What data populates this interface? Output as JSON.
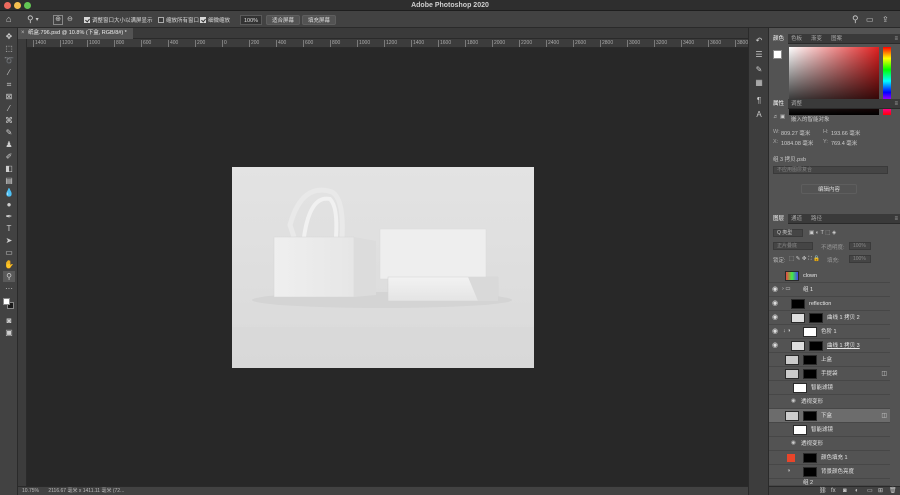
{
  "titlebar": {
    "app_title": "Adobe Photoshop 2020"
  },
  "options_bar": {
    "resize_windows": "调整窗口大小以满屏显示",
    "zoom_all_windows": "缩放所有窗口",
    "scrubby_zoom": "细微缩放",
    "zoom_value": "100%",
    "fit_screen": "适合屏幕",
    "fill_screen": "填充屏幕"
  },
  "document": {
    "tab_title": "纸盒.796.psd @ 10.8% (下盒, RGB/8#) *"
  },
  "ruler_ticks": [
    "1400",
    "1200",
    "1000",
    "800",
    "600",
    "400",
    "200",
    "0",
    "200",
    "400",
    "600",
    "800",
    "1000",
    "1200",
    "1400",
    "1600",
    "1800",
    "2000",
    "2200",
    "2400",
    "2600",
    "2800",
    "3000",
    "3200",
    "3400",
    "3600",
    "3800"
  ],
  "status_bar": {
    "zoom": "10.75%",
    "doc_info": "2116.67 毫米 x 1411.11 毫米 (72..."
  },
  "color_panel": {
    "tabs": [
      "颜色",
      "色板",
      "渐变",
      "图案"
    ],
    "colors": {
      "foreground": "#ffffff",
      "background": "#1a1a1a"
    }
  },
  "properties_panel": {
    "tabs": [
      "属性",
      "调整"
    ],
    "type_label": "嵌入的智能对象",
    "w_label": "W:",
    "w_value": "809.27 毫米",
    "h_label": "H:",
    "h_value": "193.66 毫米",
    "x_label": "X:",
    "x_value": "1084.08 毫米",
    "y_label": "Y:",
    "y_value": "769.4 毫米",
    "file_name": "组 3 拷贝.psb",
    "comp_placeholder": "不应用图层复合",
    "edit_button": "编辑内容"
  },
  "layers_panel": {
    "tabs": [
      "图层",
      "通道",
      "路径"
    ],
    "filter_label": "Q 类型",
    "blend_mode": "正片叠底",
    "opacity_label": "不透明度:",
    "opacity_value": "100%",
    "lock_label": "锁定:",
    "fill_label": "填充:",
    "fill_value": "100%",
    "layers": [
      {
        "name": "clown"
      },
      {
        "name": "组 1"
      },
      {
        "name": "reflection"
      },
      {
        "name": "曲线 1 拷贝 2"
      },
      {
        "name": "色阶 1"
      },
      {
        "name": "曲线 1 拷贝 3"
      },
      {
        "name": "上盒"
      },
      {
        "name": "手提袋"
      },
      {
        "name": "智能滤镜"
      },
      {
        "name": "透视变形"
      },
      {
        "name": "下盒"
      },
      {
        "name": "智能滤镜"
      },
      {
        "name": "透视变形"
      },
      {
        "name": "颜色填充 1"
      },
      {
        "name": "背景颜色亮度"
      },
      {
        "name": "组 2"
      }
    ]
  }
}
